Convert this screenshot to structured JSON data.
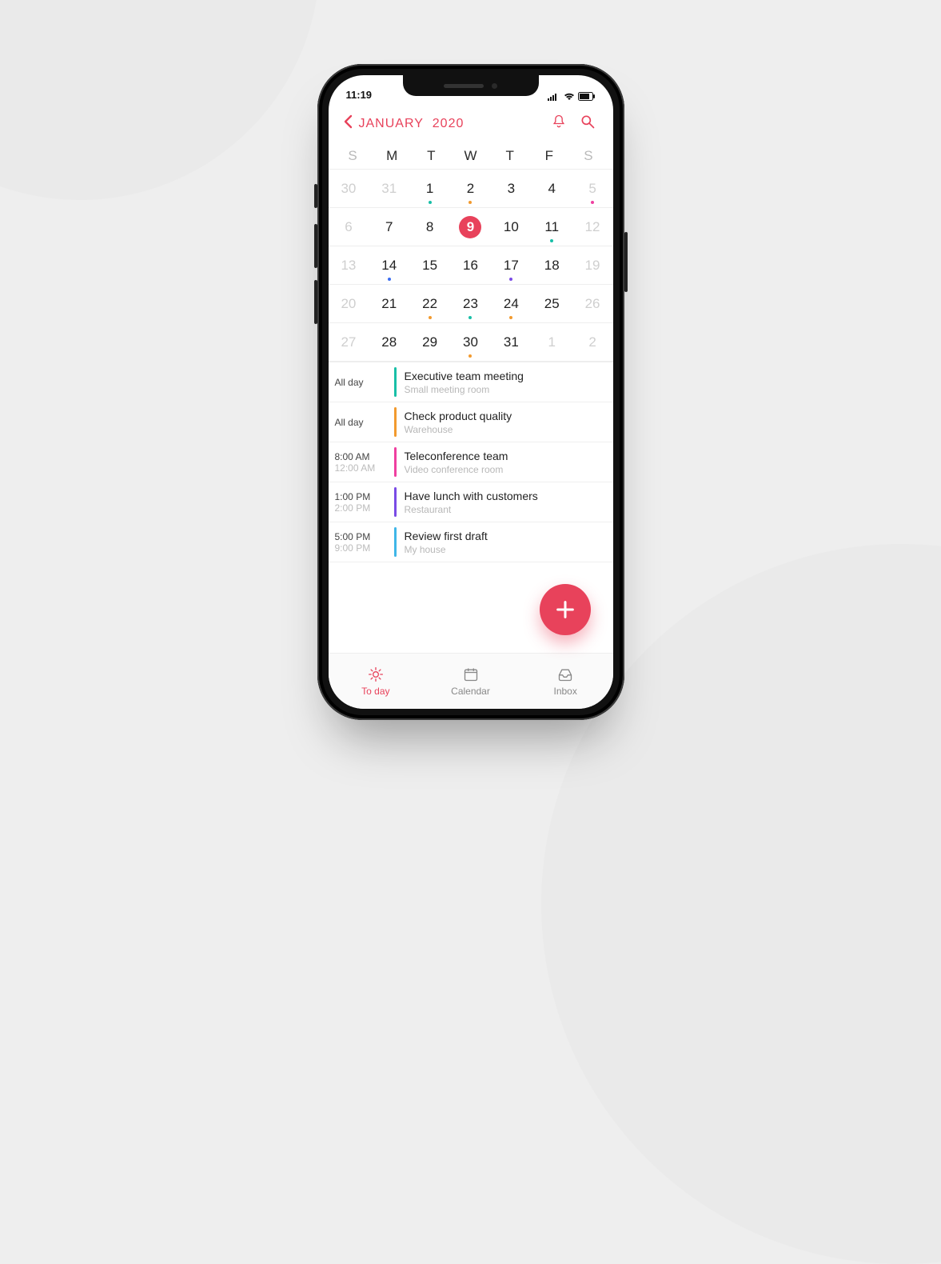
{
  "status": {
    "time": "11:19"
  },
  "header": {
    "month": "JANUARY",
    "year": "2020"
  },
  "weekdays": [
    "S",
    "M",
    "T",
    "W",
    "T",
    "F",
    "S"
  ],
  "colors": {
    "accent": "#e8425b",
    "teal": "#18bfa7",
    "orange": "#f29a2e",
    "blue": "#3a6cf0",
    "purple": "#7a4be6",
    "pink": "#ef3fa0",
    "sky": "#3fb6e8"
  },
  "month_grid": [
    [
      {
        "n": "30",
        "muted": true
      },
      {
        "n": "31",
        "muted": true
      },
      {
        "n": "1",
        "dot": "#18bfa7"
      },
      {
        "n": "2",
        "dot": "#f29a2e"
      },
      {
        "n": "3"
      },
      {
        "n": "4"
      },
      {
        "n": "5",
        "muted": true,
        "dot": "#ef3fa0"
      }
    ],
    [
      {
        "n": "6",
        "muted": true
      },
      {
        "n": "7"
      },
      {
        "n": "8"
      },
      {
        "n": "9",
        "selected": true
      },
      {
        "n": "10"
      },
      {
        "n": "11",
        "dot": "#18bfa7"
      },
      {
        "n": "12",
        "muted": true
      }
    ],
    [
      {
        "n": "13",
        "muted": true
      },
      {
        "n": "14",
        "dot": "#3a6cf0"
      },
      {
        "n": "15"
      },
      {
        "n": "16"
      },
      {
        "n": "17",
        "dot": "#7a4be6"
      },
      {
        "n": "18"
      },
      {
        "n": "19",
        "muted": true
      }
    ],
    [
      {
        "n": "20",
        "muted": true
      },
      {
        "n": "21"
      },
      {
        "n": "22",
        "dot": "#f29a2e"
      },
      {
        "n": "23",
        "dot": "#18bfa7"
      },
      {
        "n": "24",
        "dot": "#f29a2e"
      },
      {
        "n": "25"
      },
      {
        "n": "26",
        "muted": true
      }
    ],
    [
      {
        "n": "27",
        "muted": true
      },
      {
        "n": "28"
      },
      {
        "n": "29"
      },
      {
        "n": "30",
        "dot": "#f29a2e"
      },
      {
        "n": "31"
      },
      {
        "n": "1",
        "muted": true
      },
      {
        "n": "2",
        "muted": true
      }
    ]
  ],
  "events": [
    {
      "time1": "All day",
      "time2": "",
      "bar": "#18bfa7",
      "title": "Executive team meeting",
      "loc": "Small meeting room"
    },
    {
      "time1": "All day",
      "time2": "",
      "bar": "#f29a2e",
      "title": "Check product quality",
      "loc": "Warehouse"
    },
    {
      "time1": "8:00 AM",
      "time2": "12:00 AM",
      "bar": "#ef3fa0",
      "title": "Teleconference team",
      "loc": "Video conference room"
    },
    {
      "time1": "1:00 PM",
      "time2": "2:00 PM",
      "bar": "#7a4be6",
      "title": "Have lunch with customers",
      "loc": "Restaurant"
    },
    {
      "time1": "5:00 PM",
      "time2": "9:00 PM",
      "bar": "#3fb6e8",
      "title": "Review first draft",
      "loc": "My house"
    }
  ],
  "tabs": {
    "today": "To day",
    "calendar": "Calendar",
    "inbox": "Inbox"
  }
}
